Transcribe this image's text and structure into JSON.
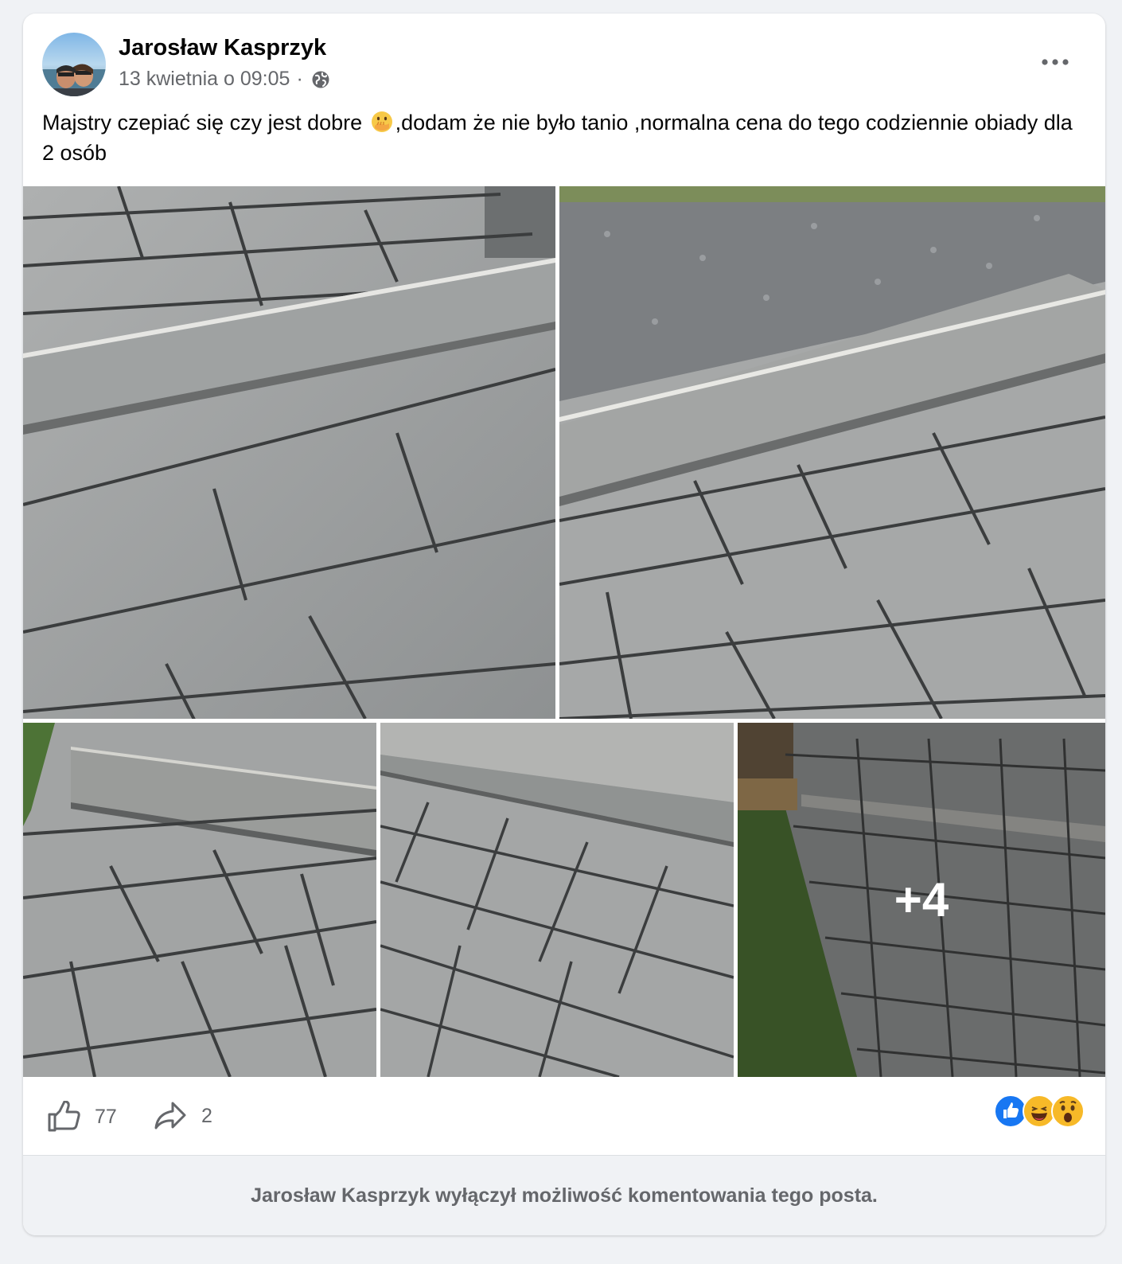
{
  "post": {
    "author": "Jarosław Kasprzyk",
    "timestamp": "13 kwietnia o 09:05",
    "separator": "·",
    "privacy_icon": "globe-icon",
    "menu_icon": "more-horizontal-icon",
    "text_before_emoji": "Majstry czepiać się czy jest dobre ",
    "emoji": "face-with-hand-over-mouth",
    "text_after_emoji": ",dodam że nie było tanio ,normalna cena do tego codziennie obiady dla 2 osób"
  },
  "gallery": {
    "photos": [
      {
        "subject": "paving-slabs-with-level-beam"
      },
      {
        "subject": "paving-slabs-with-level-beam-gravel"
      },
      {
        "subject": "paving-slabs-beam-closeup"
      },
      {
        "subject": "paving-slabs-beam-wide"
      },
      {
        "subject": "driveway-overview"
      }
    ],
    "more_count": "+4"
  },
  "actions": {
    "like_icon": "thumbs-up-icon",
    "like_count": "77",
    "share_icon": "share-arrow-icon",
    "share_count": "2",
    "reactions": [
      "like",
      "haha",
      "wow"
    ]
  },
  "footer": {
    "comments_disabled": "Jarosław Kasprzyk wyłączył możliwość komentowania tego posta."
  },
  "colors": {
    "background": "#f0f2f5",
    "card": "#ffffff",
    "secondary_text": "#65676b",
    "like_blue": "#1877f2",
    "reaction_yellow": "#f7b928"
  }
}
